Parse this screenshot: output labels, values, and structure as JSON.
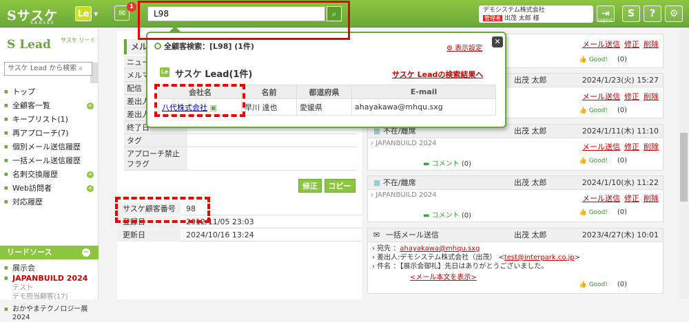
{
  "header": {
    "logo": "Sサスケ",
    "logo_sub": "SAASKE",
    "app_badge": "Le",
    "notification_count": "1",
    "search_value": "L98",
    "company": "デモシステム株式会社",
    "admin_tag": "管理者",
    "user": "出茂 太郎 様",
    "logout_label": "Logout"
  },
  "sidebar": {
    "title": "Lead",
    "title_sub": "サスケ リード",
    "search_placeholder": "サスケ Lead から検索",
    "items": [
      {
        "label": "トップ"
      },
      {
        "label": "全顧客一覧"
      },
      {
        "label": "キープリスト(1)"
      },
      {
        "label": "再アプローチ(7)"
      },
      {
        "label": "個別メール送信履歴"
      },
      {
        "label": "一括メール送信履歴"
      },
      {
        "label": "名刺交換履歴"
      },
      {
        "label": "Web訪問者"
      },
      {
        "label": "対応履歴"
      }
    ],
    "lead_source_header": "リードソース",
    "sources": {
      "exhibition": "展示会",
      "japanbuild": "JAPANBUILD 2024",
      "test": "テスト",
      "demo": "デモ担当顧客(17)",
      "okayama": "おかやまテクノロジー展 2024"
    }
  },
  "detail": {
    "mail_tab": "メル",
    "rows": [
      "ニュー",
      "メルマ",
      "配信",
      "差出人",
      "差出人",
      "終了日",
      "タグ",
      "アプローチ禁止フラグ"
    ],
    "edit_label": "修正",
    "copy_label": "コピー",
    "customer_no_label": "サスケ顧客番号",
    "customer_no": "98",
    "registered_label": "登録日",
    "registered": "2012/11/05 23:03",
    "updated_label": "更新日",
    "updated": "2024/10/16 13:24"
  },
  "popup": {
    "title": "全顧客検索：[L98] (1件)",
    "display_setting": "表示設定",
    "section_title": "サスケ Lead(1件)",
    "results_link": "サスケ Leadの検索結果へ",
    "columns": [
      "会社名",
      "名前",
      "都道府県",
      "E-mail"
    ],
    "rows": [
      {
        "company": "八代株式会社",
        "name": "早川 達也",
        "pref": "愛媛県",
        "email": "ahayakawa@mhqu.sxg"
      }
    ]
  },
  "activities": {
    "send_link": "メール送信",
    "edit_link": "修正",
    "delete_link": "削除",
    "good_label": "Good!",
    "comment_label": "コメント",
    "a1": {
      "good": "(0)"
    },
    "a2": {
      "user": "出茂 太郎",
      "date": "2024/1/23(火) 15:27",
      "good": "(0)"
    },
    "a3": {
      "type": "不在/離席",
      "user": "出茂 太郎",
      "date": "2024/1/11(木) 11:10",
      "sub": "JAPANBUILD 2024",
      "comment": "(0)",
      "good": "(0)"
    },
    "a4": {
      "type": "不在/離席",
      "user": "出茂 太郎",
      "date": "2024/1/10(水) 11:22",
      "sub": "JAPANBUILD 2024",
      "comment": "(0)",
      "good": "(0)"
    },
    "a5": {
      "type": "一括メール送信",
      "user": "出茂 太郎",
      "date": "2023/4/27(木) 10:01",
      "to_label": "宛先 ：",
      "to": "ahayakawa@mhqu.sxg",
      "from_label": "差出人:デモシステム株式会社（出茂）",
      "from": "test@interpark.co.jp",
      "subject": "件名 ：【展示会御礼】先日はありがとうございました。",
      "show_body": "<メール本文を表示>",
      "good": "(0)"
    }
  }
}
